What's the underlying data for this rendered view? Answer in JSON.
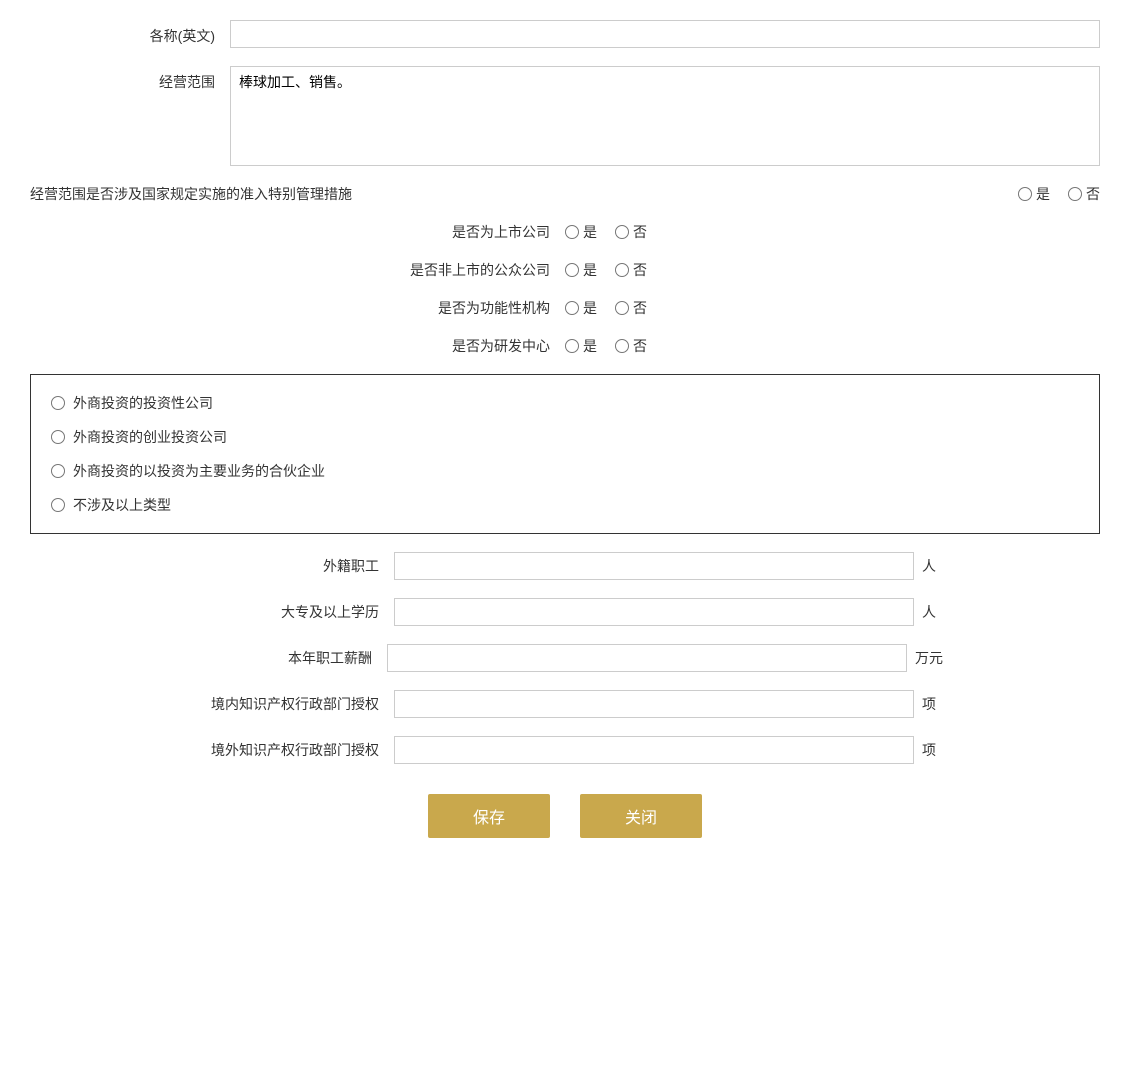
{
  "form": {
    "name_en_label": "各称(英文)",
    "business_scope_label": "经营范围",
    "business_scope_value": "棒球加工、销售。",
    "special_mgmt_label": "经营范围是否涉及国家规定实施的准入特别管理措施",
    "listed_company_label": "是否为上市公司",
    "non_listed_public_label": "是否非上市的公众公司",
    "functional_org_label": "是否为功能性机构",
    "rd_center_label": "是否为研发中心",
    "yes_label": "是",
    "no_label": "否",
    "foreign_investment_options": [
      "外商投资的投资性公司",
      "外商投资的创业投资公司",
      "外商投资的以投资为主要业务的合伙企业",
      "不涉及以上类型"
    ],
    "foreign_workers_label": "外籍职工",
    "foreign_workers_unit": "人",
    "college_above_label": "大专及以上学历",
    "college_above_unit": "人",
    "annual_salary_label": "本年职工薪酬",
    "annual_salary_unit": "万元",
    "domestic_ip_label": "境内知识产权行政部门授权",
    "domestic_ip_unit": "项",
    "foreign_ip_label": "境外知识产权行政部门授权",
    "foreign_ip_unit": "项",
    "save_button": "保存",
    "close_button": "关闭"
  }
}
